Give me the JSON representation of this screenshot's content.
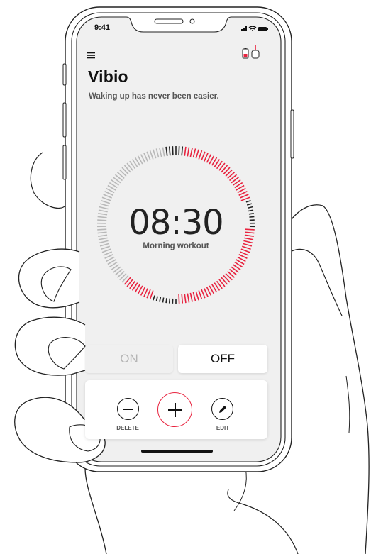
{
  "status_bar": {
    "time": "9:41",
    "signal_icon": "signal-icon",
    "wifi_icon": "wifi-icon",
    "battery_icon": "battery-icon"
  },
  "header": {
    "menu_icon": "hamburger-menu-icon",
    "title": "Vibio",
    "subtitle": "Waking up has never been easier.",
    "device_icons": [
      "phone-battery-icon",
      "vibio-device-icon"
    ]
  },
  "clock": {
    "time": "08:30",
    "label": "Morning workout"
  },
  "toggle": {
    "on_label": "ON",
    "off_label": "OFF",
    "selected": "OFF"
  },
  "actions": {
    "delete_label": "DELETE",
    "edit_label": "EDIT",
    "add_icon": "plus-icon"
  },
  "colors": {
    "accent": "#e8233f",
    "inactive_ticks": "#b8b8b8",
    "dark_ticks": "#222222",
    "screen_bg": "#f0f0f0"
  }
}
